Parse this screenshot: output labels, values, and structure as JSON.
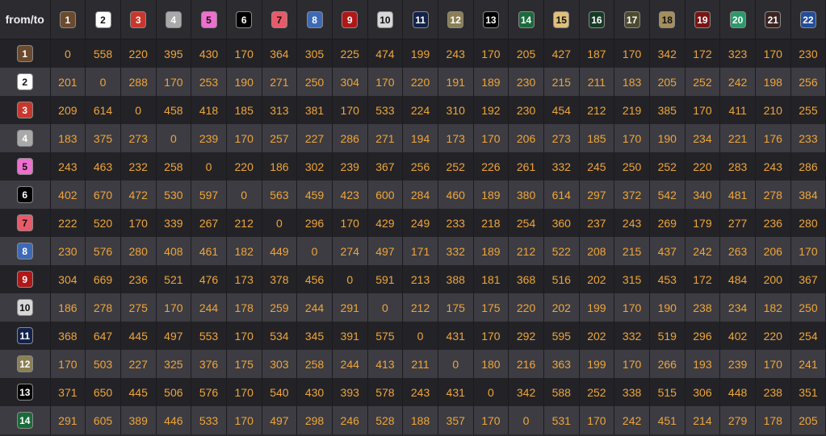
{
  "corner_label": "from/to",
  "stations": [
    {
      "label": "1",
      "color": "#6b4a2e",
      "text": "#ffffff"
    },
    {
      "label": "2",
      "color": "#ffffff",
      "text": "#111111"
    },
    {
      "label": "3",
      "color": "#c8372d",
      "text": "#ffffff"
    },
    {
      "label": "4",
      "color": "#a9a9a9",
      "text": "#ffffff"
    },
    {
      "label": "5",
      "color": "#ee6fcf",
      "text": "#111111"
    },
    {
      "label": "6",
      "color": "#000000",
      "text": "#ffffff"
    },
    {
      "label": "7",
      "color": "#e85a6a",
      "text": "#111111"
    },
    {
      "label": "8",
      "color": "#3d6ab7",
      "text": "#ffffff"
    },
    {
      "label": "9",
      "color": "#b01717",
      "text": "#ffffff"
    },
    {
      "label": "10",
      "color": "#d8d8d8",
      "text": "#111111"
    },
    {
      "label": "11",
      "color": "#12224a",
      "text": "#ffffff"
    },
    {
      "label": "12",
      "color": "#8a7f55",
      "text": "#ffffff"
    },
    {
      "label": "13",
      "color": "#000000",
      "text": "#ffffff"
    },
    {
      "label": "14",
      "color": "#1a6b3b",
      "text": "#ffffff"
    },
    {
      "label": "15",
      "color": "#e0c07a",
      "text": "#111111"
    },
    {
      "label": "16",
      "color": "#163b25",
      "text": "#ffffff"
    },
    {
      "label": "17",
      "color": "#4d4b2f",
      "text": "#ffffff"
    },
    {
      "label": "18",
      "color": "#a58f5d",
      "text": "#111111"
    },
    {
      "label": "19",
      "color": "#7a1414",
      "text": "#ffffff"
    },
    {
      "label": "20",
      "color": "#2a9a6a",
      "text": "#ffffff"
    },
    {
      "label": "21",
      "color": "#3a2420",
      "text": "#ffffff"
    },
    {
      "label": "22",
      "color": "#234d9a",
      "text": "#ffffff"
    }
  ],
  "rows": [
    {
      "from": "1",
      "values": [
        "0",
        "558",
        "220",
        "395",
        "430",
        "170",
        "364",
        "305",
        "225",
        "474",
        "199",
        "243",
        "170",
        "205",
        "427",
        "187",
        "170",
        "342",
        "172",
        "323",
        "170",
        "230"
      ]
    },
    {
      "from": "2",
      "values": [
        "201",
        "0",
        "288",
        "170",
        "253",
        "190",
        "271",
        "250",
        "304",
        "170",
        "220",
        "191",
        "189",
        "230",
        "215",
        "211",
        "183",
        "205",
        "252",
        "242",
        "198",
        "256"
      ]
    },
    {
      "from": "3",
      "values": [
        "209",
        "614",
        "0",
        "458",
        "418",
        "185",
        "313",
        "381",
        "170",
        "533",
        "224",
        "310",
        "192",
        "230",
        "454",
        "212",
        "219",
        "385",
        "170",
        "411",
        "210",
        "255"
      ]
    },
    {
      "from": "4",
      "values": [
        "183",
        "375",
        "273",
        "0",
        "239",
        "170",
        "257",
        "227",
        "286",
        "271",
        "194",
        "173",
        "170",
        "206",
        "273",
        "185",
        "170",
        "190",
        "234",
        "221",
        "176",
        "233"
      ]
    },
    {
      "from": "5",
      "values": [
        "243",
        "463",
        "232",
        "258",
        "0",
        "220",
        "186",
        "302",
        "239",
        "367",
        "256",
        "252",
        "226",
        "261",
        "332",
        "245",
        "250",
        "252",
        "220",
        "283",
        "243",
        "286"
      ]
    },
    {
      "from": "6",
      "values": [
        "402",
        "670",
        "472",
        "530",
        "597",
        "0",
        "563",
        "459",
        "423",
        "600",
        "284",
        "460",
        "189",
        "380",
        "614",
        "297",
        "372",
        "542",
        "340",
        "481",
        "278",
        "384"
      ]
    },
    {
      "from": "7",
      "values": [
        "222",
        "520",
        "170",
        "339",
        "267",
        "212",
        "0",
        "296",
        "170",
        "429",
        "249",
        "233",
        "218",
        "254",
        "360",
        "237",
        "243",
        "269",
        "179",
        "277",
        "236",
        "280"
      ]
    },
    {
      "from": "8",
      "values": [
        "230",
        "576",
        "280",
        "408",
        "461",
        "182",
        "449",
        "0",
        "274",
        "497",
        "171",
        "332",
        "189",
        "212",
        "522",
        "208",
        "215",
        "437",
        "242",
        "263",
        "206",
        "170"
      ]
    },
    {
      "from": "9",
      "values": [
        "304",
        "669",
        "236",
        "521",
        "476",
        "173",
        "378",
        "456",
        "0",
        "591",
        "213",
        "388",
        "181",
        "368",
        "516",
        "202",
        "315",
        "453",
        "172",
        "484",
        "200",
        "367"
      ]
    },
    {
      "from": "10",
      "values": [
        "186",
        "278",
        "275",
        "170",
        "244",
        "178",
        "259",
        "244",
        "291",
        "0",
        "212",
        "175",
        "175",
        "220",
        "202",
        "199",
        "170",
        "190",
        "238",
        "234",
        "182",
        "250"
      ]
    },
    {
      "from": "11",
      "values": [
        "368",
        "647",
        "445",
        "497",
        "553",
        "170",
        "534",
        "345",
        "391",
        "575",
        "0",
        "431",
        "170",
        "292",
        "595",
        "202",
        "332",
        "519",
        "296",
        "402",
        "220",
        "254"
      ]
    },
    {
      "from": "12",
      "values": [
        "170",
        "503",
        "227",
        "325",
        "376",
        "175",
        "303",
        "258",
        "244",
        "413",
        "211",
        "0",
        "180",
        "216",
        "363",
        "199",
        "170",
        "266",
        "193",
        "239",
        "170",
        "241"
      ]
    },
    {
      "from": "13",
      "values": [
        "371",
        "650",
        "445",
        "506",
        "576",
        "170",
        "540",
        "430",
        "393",
        "578",
        "243",
        "431",
        "0",
        "342",
        "588",
        "252",
        "338",
        "515",
        "306",
        "448",
        "238",
        "351"
      ]
    },
    {
      "from": "14",
      "values": [
        "291",
        "605",
        "389",
        "446",
        "533",
        "170",
        "497",
        "298",
        "246",
        "528",
        "188",
        "357",
        "170",
        "0",
        "531",
        "170",
        "242",
        "451",
        "214",
        "279",
        "178",
        "205"
      ]
    }
  ]
}
